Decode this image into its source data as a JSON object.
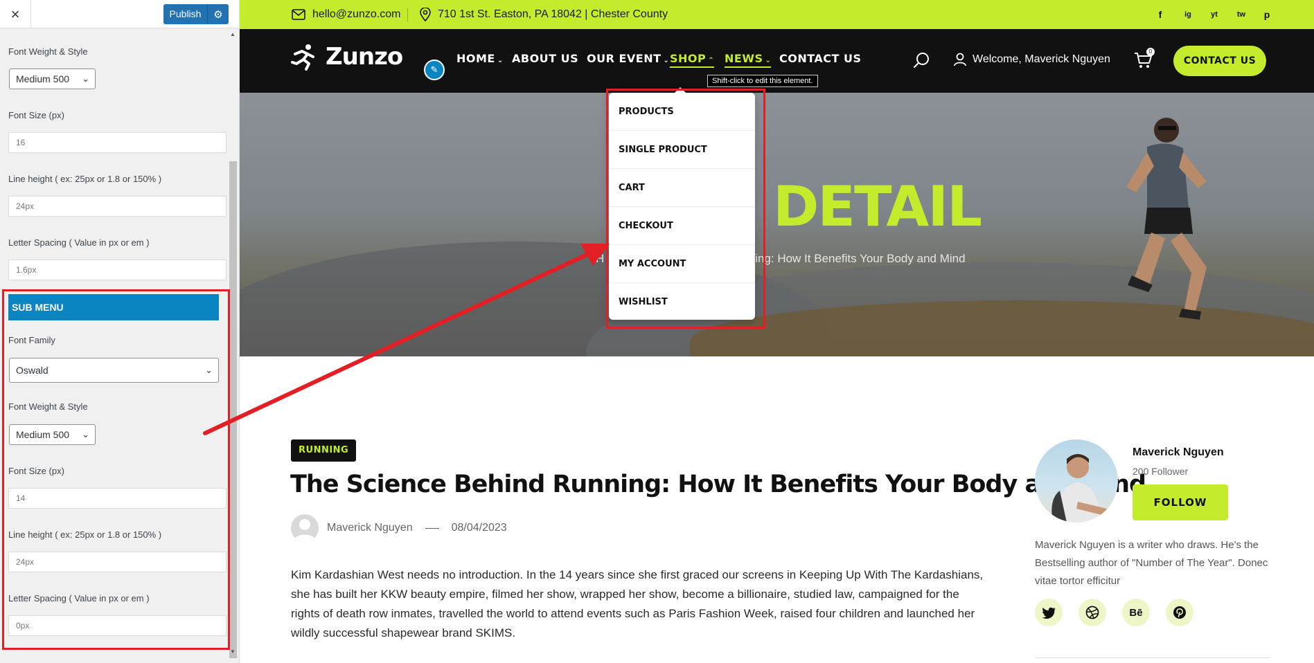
{
  "customizer": {
    "close_label": "×",
    "publish_label": "Publish",
    "menu_section": {
      "weight_label": "Font Weight & Style",
      "weight_value": "Medium 500",
      "size_label": "Font Size (px)",
      "size_value": "16",
      "line_height_label": "Line height ( ex: 25px or 1.8 or 150% )",
      "line_height_value": "24px",
      "letter_spacing_label": "Letter Spacing ( Value in px or em )",
      "letter_spacing_value": "1.6px"
    },
    "sub_menu": {
      "title": "SUB MENU",
      "family_label": "Font Family",
      "family_value": "Oswald",
      "weight_label": "Font Weight & Style",
      "weight_value": "Medium 500",
      "size_label": "Font Size (px)",
      "size_value": "14",
      "line_height_label": "Line height ( ex: 25px or 1.8 or 150% )",
      "line_height_value": "24px",
      "letter_spacing_label": "Letter Spacing ( Value in px or em )",
      "letter_spacing_value": "0px"
    }
  },
  "site": {
    "topbar": {
      "email": "hello@zunzo.com",
      "address": "710 1st St. Easton, PA 18042 | Chester County",
      "socials": [
        "f",
        "ig",
        "yt",
        "tw",
        "p"
      ]
    },
    "brand": "Zunzo",
    "nav": [
      {
        "label": "HOME",
        "has_caret": true
      },
      {
        "label": "ABOUT US",
        "has_caret": false
      },
      {
        "label": "OUR EVENT",
        "has_caret": true
      },
      {
        "label": "SHOP",
        "has_caret": true
      },
      {
        "label": "NEWS",
        "has_caret": true
      },
      {
        "label": "CONTACT US",
        "has_caret": false
      }
    ],
    "welcome": "Welcome, Maverick Nguyen",
    "cart_count": "0",
    "contact_button": "CONTACT US",
    "tooltip": "Shift-click to edit this element.",
    "shop_submenu": [
      "PRODUCTS",
      "SINGLE PRODUCT",
      "CART",
      "CHECKOUT",
      "MY ACCOUNT",
      "WISHLIST"
    ],
    "hero": {
      "title": "DETAIL",
      "breadcrumb_start": "H",
      "breadcrumb_end": "nning: How It Benefits Your Body and Mind"
    },
    "post": {
      "category": "RUNNING",
      "title": "The Science Behind Running: How It Benefits Your Body and Mind",
      "author": "Maverick Nguyen",
      "date": "08/04/2023",
      "body": "Kim Kardashian West needs no introduction. In the 14 years since she first graced our screens in Keeping Up With The Kardashians, she has built her KKW beauty empire, filmed her show, wrapped her show, become a billionaire, studied law, campaigned for the rights of death row inmates, travelled the world to attend events such as Paris Fashion Week, raised four children and launched her wildly successful shapewear brand SKIMS."
    },
    "author_card": {
      "name": "Maverick Nguyen",
      "followers": "200 Follower",
      "follow_button": "FOLLOW",
      "bio": "Maverick Nguyen is a writer who draws. He's the Bestselling author of \"Number of The Year\". Donec vitae tortor efficitur",
      "socials": [
        "twitter",
        "dribbble",
        "Bē",
        "pinterest"
      ]
    },
    "colors": {
      "accent": "#c5eb2d",
      "dark": "#111111",
      "customizer_blue": "#0a85c2",
      "annotation_red": "#e31e24"
    }
  }
}
